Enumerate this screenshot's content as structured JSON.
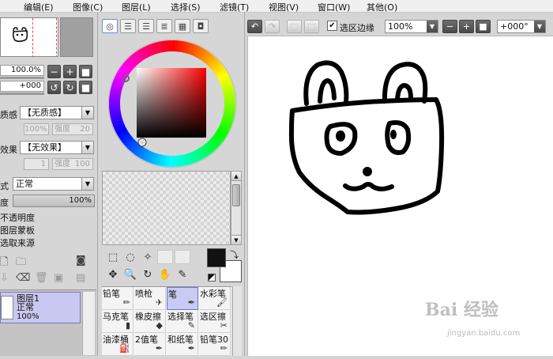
{
  "menu": [
    "编辑(E)",
    "图像(C)",
    "图层(L)",
    "选择(S)",
    "滤镜(T)",
    "视图(V)",
    "窗口(W)",
    "其他(O)"
  ],
  "navigator": {
    "zoom": "100.0%",
    "angle": "+000"
  },
  "texture": {
    "label": "质感",
    "value": "【无质感】",
    "scale": "100%",
    "strength_label": "强度",
    "strength": "20"
  },
  "effect": {
    "label": "效果",
    "value": "【无效果】",
    "width": "1",
    "strength_label": "强度",
    "strength": "100"
  },
  "blend": {
    "label": "式",
    "value": "正常"
  },
  "opacity": {
    "label": "度",
    "value": "100%"
  },
  "checks": [
    "不透明度",
    "图层蒙板",
    "选取来源"
  ],
  "layer": {
    "name": "图层1",
    "mode": "正常",
    "opacity": "100%"
  },
  "brushes": [
    {
      "name": "铅笔",
      "icon": "pencil-icon"
    },
    {
      "name": "喷枪",
      "icon": "airbrush-icon"
    },
    {
      "name": "笔",
      "icon": "pen-icon",
      "active": true
    },
    {
      "name": "水彩笔",
      "icon": "watercolor-icon"
    },
    {
      "name": "马克笔",
      "icon": "marker-icon"
    },
    {
      "name": "橡皮擦",
      "icon": "eraser-icon"
    },
    {
      "name": "选择笔",
      "icon": "select-pen-icon"
    },
    {
      "name": "选区擦",
      "icon": "select-eraser-icon"
    },
    {
      "name": "油漆桶",
      "icon": "bucket-icon"
    },
    {
      "name": "2值笔",
      "icon": "binary-pen-icon"
    },
    {
      "name": "和纸笔",
      "icon": "washi-pen-icon"
    },
    {
      "name": "铅笔30",
      "icon": "pencil-icon"
    }
  ],
  "canvas_toolbar": {
    "selection_edge_label": "选区边缘",
    "selection_edge_checked": true,
    "zoom": "100%",
    "rotation": "+000°"
  },
  "colors": {
    "foreground": "#111111",
    "background": "#ffffff",
    "selected_layer": "#c8c8f0",
    "accent": "#6a74c8"
  },
  "watermark": {
    "line1": "Bai 经验",
    "line2": "jingyan.baidu.com"
  }
}
